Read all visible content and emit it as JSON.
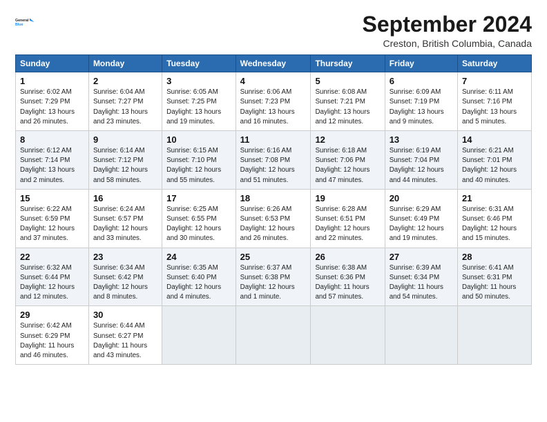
{
  "logo": {
    "line1": "General",
    "line2": "Blue"
  },
  "title": "September 2024",
  "subtitle": "Creston, British Columbia, Canada",
  "days_of_week": [
    "Sunday",
    "Monday",
    "Tuesday",
    "Wednesday",
    "Thursday",
    "Friday",
    "Saturday"
  ],
  "weeks": [
    {
      "row_shade": "light",
      "days": [
        {
          "num": "1",
          "sunrise": "6:02 AM",
          "sunset": "7:29 PM",
          "daylight": "13 hours and 26 minutes."
        },
        {
          "num": "2",
          "sunrise": "6:04 AM",
          "sunset": "7:27 PM",
          "daylight": "13 hours and 23 minutes."
        },
        {
          "num": "3",
          "sunrise": "6:05 AM",
          "sunset": "7:25 PM",
          "daylight": "13 hours and 19 minutes."
        },
        {
          "num": "4",
          "sunrise": "6:06 AM",
          "sunset": "7:23 PM",
          "daylight": "13 hours and 16 minutes."
        },
        {
          "num": "5",
          "sunrise": "6:08 AM",
          "sunset": "7:21 PM",
          "daylight": "13 hours and 12 minutes."
        },
        {
          "num": "6",
          "sunrise": "6:09 AM",
          "sunset": "7:19 PM",
          "daylight": "13 hours and 9 minutes."
        },
        {
          "num": "7",
          "sunrise": "6:11 AM",
          "sunset": "7:16 PM",
          "daylight": "13 hours and 5 minutes."
        }
      ]
    },
    {
      "row_shade": "medium",
      "days": [
        {
          "num": "8",
          "sunrise": "6:12 AM",
          "sunset": "7:14 PM",
          "daylight": "13 hours and 2 minutes."
        },
        {
          "num": "9",
          "sunrise": "6:14 AM",
          "sunset": "7:12 PM",
          "daylight": "12 hours and 58 minutes."
        },
        {
          "num": "10",
          "sunrise": "6:15 AM",
          "sunset": "7:10 PM",
          "daylight": "12 hours and 55 minutes."
        },
        {
          "num": "11",
          "sunrise": "6:16 AM",
          "sunset": "7:08 PM",
          "daylight": "12 hours and 51 minutes."
        },
        {
          "num": "12",
          "sunrise": "6:18 AM",
          "sunset": "7:06 PM",
          "daylight": "12 hours and 47 minutes."
        },
        {
          "num": "13",
          "sunrise": "6:19 AM",
          "sunset": "7:04 PM",
          "daylight": "12 hours and 44 minutes."
        },
        {
          "num": "14",
          "sunrise": "6:21 AM",
          "sunset": "7:01 PM",
          "daylight": "12 hours and 40 minutes."
        }
      ]
    },
    {
      "row_shade": "light",
      "days": [
        {
          "num": "15",
          "sunrise": "6:22 AM",
          "sunset": "6:59 PM",
          "daylight": "12 hours and 37 minutes."
        },
        {
          "num": "16",
          "sunrise": "6:24 AM",
          "sunset": "6:57 PM",
          "daylight": "12 hours and 33 minutes."
        },
        {
          "num": "17",
          "sunrise": "6:25 AM",
          "sunset": "6:55 PM",
          "daylight": "12 hours and 30 minutes."
        },
        {
          "num": "18",
          "sunrise": "6:26 AM",
          "sunset": "6:53 PM",
          "daylight": "12 hours and 26 minutes."
        },
        {
          "num": "19",
          "sunrise": "6:28 AM",
          "sunset": "6:51 PM",
          "daylight": "12 hours and 22 minutes."
        },
        {
          "num": "20",
          "sunrise": "6:29 AM",
          "sunset": "6:49 PM",
          "daylight": "12 hours and 19 minutes."
        },
        {
          "num": "21",
          "sunrise": "6:31 AM",
          "sunset": "6:46 PM",
          "daylight": "12 hours and 15 minutes."
        }
      ]
    },
    {
      "row_shade": "medium",
      "days": [
        {
          "num": "22",
          "sunrise": "6:32 AM",
          "sunset": "6:44 PM",
          "daylight": "12 hours and 12 minutes."
        },
        {
          "num": "23",
          "sunrise": "6:34 AM",
          "sunset": "6:42 PM",
          "daylight": "12 hours and 8 minutes."
        },
        {
          "num": "24",
          "sunrise": "6:35 AM",
          "sunset": "6:40 PM",
          "daylight": "12 hours and 4 minutes."
        },
        {
          "num": "25",
          "sunrise": "6:37 AM",
          "sunset": "6:38 PM",
          "daylight": "12 hours and 1 minute."
        },
        {
          "num": "26",
          "sunrise": "6:38 AM",
          "sunset": "6:36 PM",
          "daylight": "11 hours and 57 minutes."
        },
        {
          "num": "27",
          "sunrise": "6:39 AM",
          "sunset": "6:34 PM",
          "daylight": "11 hours and 54 minutes."
        },
        {
          "num": "28",
          "sunrise": "6:41 AM",
          "sunset": "6:31 PM",
          "daylight": "11 hours and 50 minutes."
        }
      ]
    },
    {
      "row_shade": "light",
      "days": [
        {
          "num": "29",
          "sunrise": "6:42 AM",
          "sunset": "6:29 PM",
          "daylight": "11 hours and 46 minutes."
        },
        {
          "num": "30",
          "sunrise": "6:44 AM",
          "sunset": "6:27 PM",
          "daylight": "11 hours and 43 minutes."
        },
        null,
        null,
        null,
        null,
        null
      ]
    }
  ]
}
